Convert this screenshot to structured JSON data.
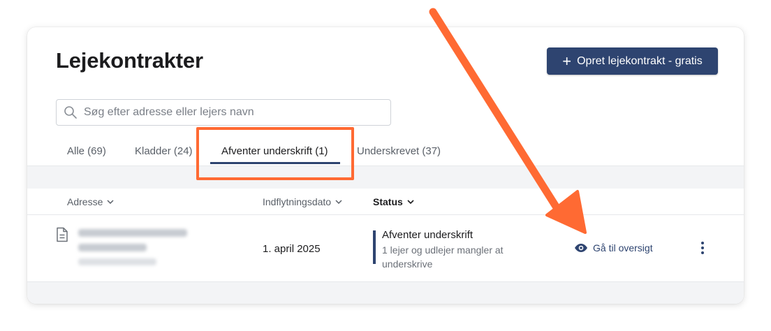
{
  "header": {
    "title": "Lejekontrakter",
    "create_button": "Opret lejekontrakt - gratis"
  },
  "search": {
    "placeholder": "Søg efter adresse eller lejers navn",
    "value": ""
  },
  "tabs": [
    {
      "label": "Alle (69)",
      "active": false
    },
    {
      "label": "Kladder (24)",
      "active": false
    },
    {
      "label": "Afventer underskrift (1)",
      "active": true
    },
    {
      "label": "Underskrevet (37)",
      "active": false
    }
  ],
  "table": {
    "columns": {
      "address": "Adresse",
      "move_in": "Indflytningsdato",
      "status": "Status"
    },
    "rows": [
      {
        "move_in": "1. april 2025",
        "status_title": "Afventer underskrift",
        "status_detail": "1 lejer og udlejer mangler at underskrive",
        "action": "Gå til oversigt"
      }
    ]
  },
  "colors": {
    "accent": "#2e4470",
    "annotation": "#ff6a33"
  },
  "icons": [
    "search-icon",
    "plus-icon",
    "chevron-down-icon",
    "document-icon",
    "eye-icon",
    "more-vertical-icon"
  ]
}
